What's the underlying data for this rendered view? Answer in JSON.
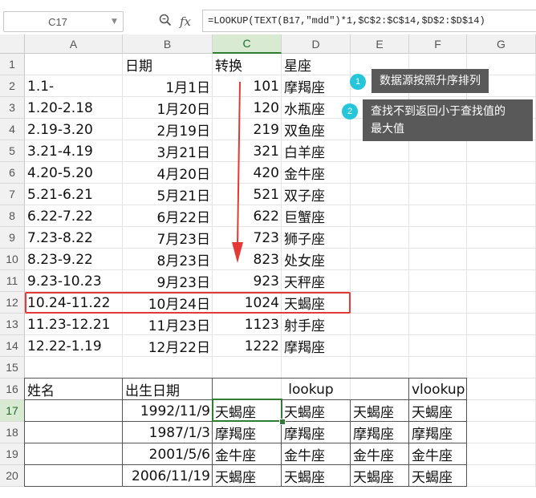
{
  "formula_bar": {
    "cell_ref": "C17",
    "formula": "=LOOKUP(TEXT(B17,\"mdd\")*1,$C$2:$C$14,$D$2:$D$14)",
    "zoom_icon": "zoom-icon",
    "fx_label": "fx"
  },
  "columns": [
    "A",
    "B",
    "C",
    "D",
    "E",
    "F",
    "G"
  ],
  "rows": [
    "1",
    "2",
    "3",
    "4",
    "5",
    "6",
    "7",
    "8",
    "9",
    "10",
    "11",
    "12",
    "13",
    "14",
    "15",
    "16",
    "17",
    "18",
    "19",
    "20"
  ],
  "header_row": {
    "b": "日期",
    "c": "转换",
    "d": "星座"
  },
  "zodiac_rows": [
    {
      "a": "1.1-",
      "b": "1月1日",
      "c": "101",
      "d": "摩羯座"
    },
    {
      "a": "1.20-2.18",
      "b": "1月20日",
      "c": "120",
      "d": "水瓶座"
    },
    {
      "a": "2.19-3.20",
      "b": "2月19日",
      "c": "219",
      "d": "双鱼座"
    },
    {
      "a": "3.21-4.19",
      "b": "3月21日",
      "c": "321",
      "d": "白羊座"
    },
    {
      "a": "4.20-5.20",
      "b": "4月20日",
      "c": "420",
      "d": "金牛座"
    },
    {
      "a": "5.21-6.21",
      "b": "5月21日",
      "c": "521",
      "d": "双子座"
    },
    {
      "a": "6.22-7.22",
      "b": "6月22日",
      "c": "622",
      "d": "巨蟹座"
    },
    {
      "a": "7.23-8.22",
      "b": "7月23日",
      "c": "723",
      "d": "狮子座"
    },
    {
      "a": "8.23-9.22",
      "b": "8月23日",
      "c": "823",
      "d": "处女座"
    },
    {
      "a": "9.23-10.23",
      "b": "9月23日",
      "c": "923",
      "d": "天秤座"
    },
    {
      "a": "10.24-11.22",
      "b": "10月24日",
      "c": "1024",
      "d": "天蝎座"
    },
    {
      "a": "11.23-12.21",
      "b": "11月23日",
      "c": "1123",
      "d": "射手座"
    },
    {
      "a": "12.22-1.19",
      "b": "12月22日",
      "c": "1222",
      "d": "摩羯座"
    }
  ],
  "lower_header": {
    "a": "姓名",
    "b": "出生日期",
    "lookup": "lookup",
    "vlookup": "vlookup"
  },
  "lower_rows": [
    {
      "a": "",
      "b": "1992/11/9",
      "c": "天蝎座",
      "d": "天蝎座",
      "e": "天蝎座",
      "f": "天蝎座"
    },
    {
      "a": "",
      "b": "1987/1/3",
      "c": "摩羯座",
      "d": "摩羯座",
      "e": "摩羯座",
      "f": "摩羯座"
    },
    {
      "a": "",
      "b": "2001/5/6",
      "c": "金牛座",
      "d": "金牛座",
      "e": "金牛座",
      "f": "金牛座"
    },
    {
      "a": "",
      "b": "2006/11/19",
      "c": "天蝎座",
      "d": "天蝎座",
      "e": "天蝎座",
      "f": "天蝎座"
    }
  ],
  "callouts": [
    {
      "num": "1",
      "text": "数据源按照升序排列"
    },
    {
      "num": "2",
      "text_line1": "查找不到返回小于查找值的",
      "text_line2": "最大值"
    }
  ],
  "colors": {
    "selection": "#2e7d32",
    "highlight": "#e53935",
    "badge": "#26c6da",
    "callout_bg": "#595959"
  }
}
